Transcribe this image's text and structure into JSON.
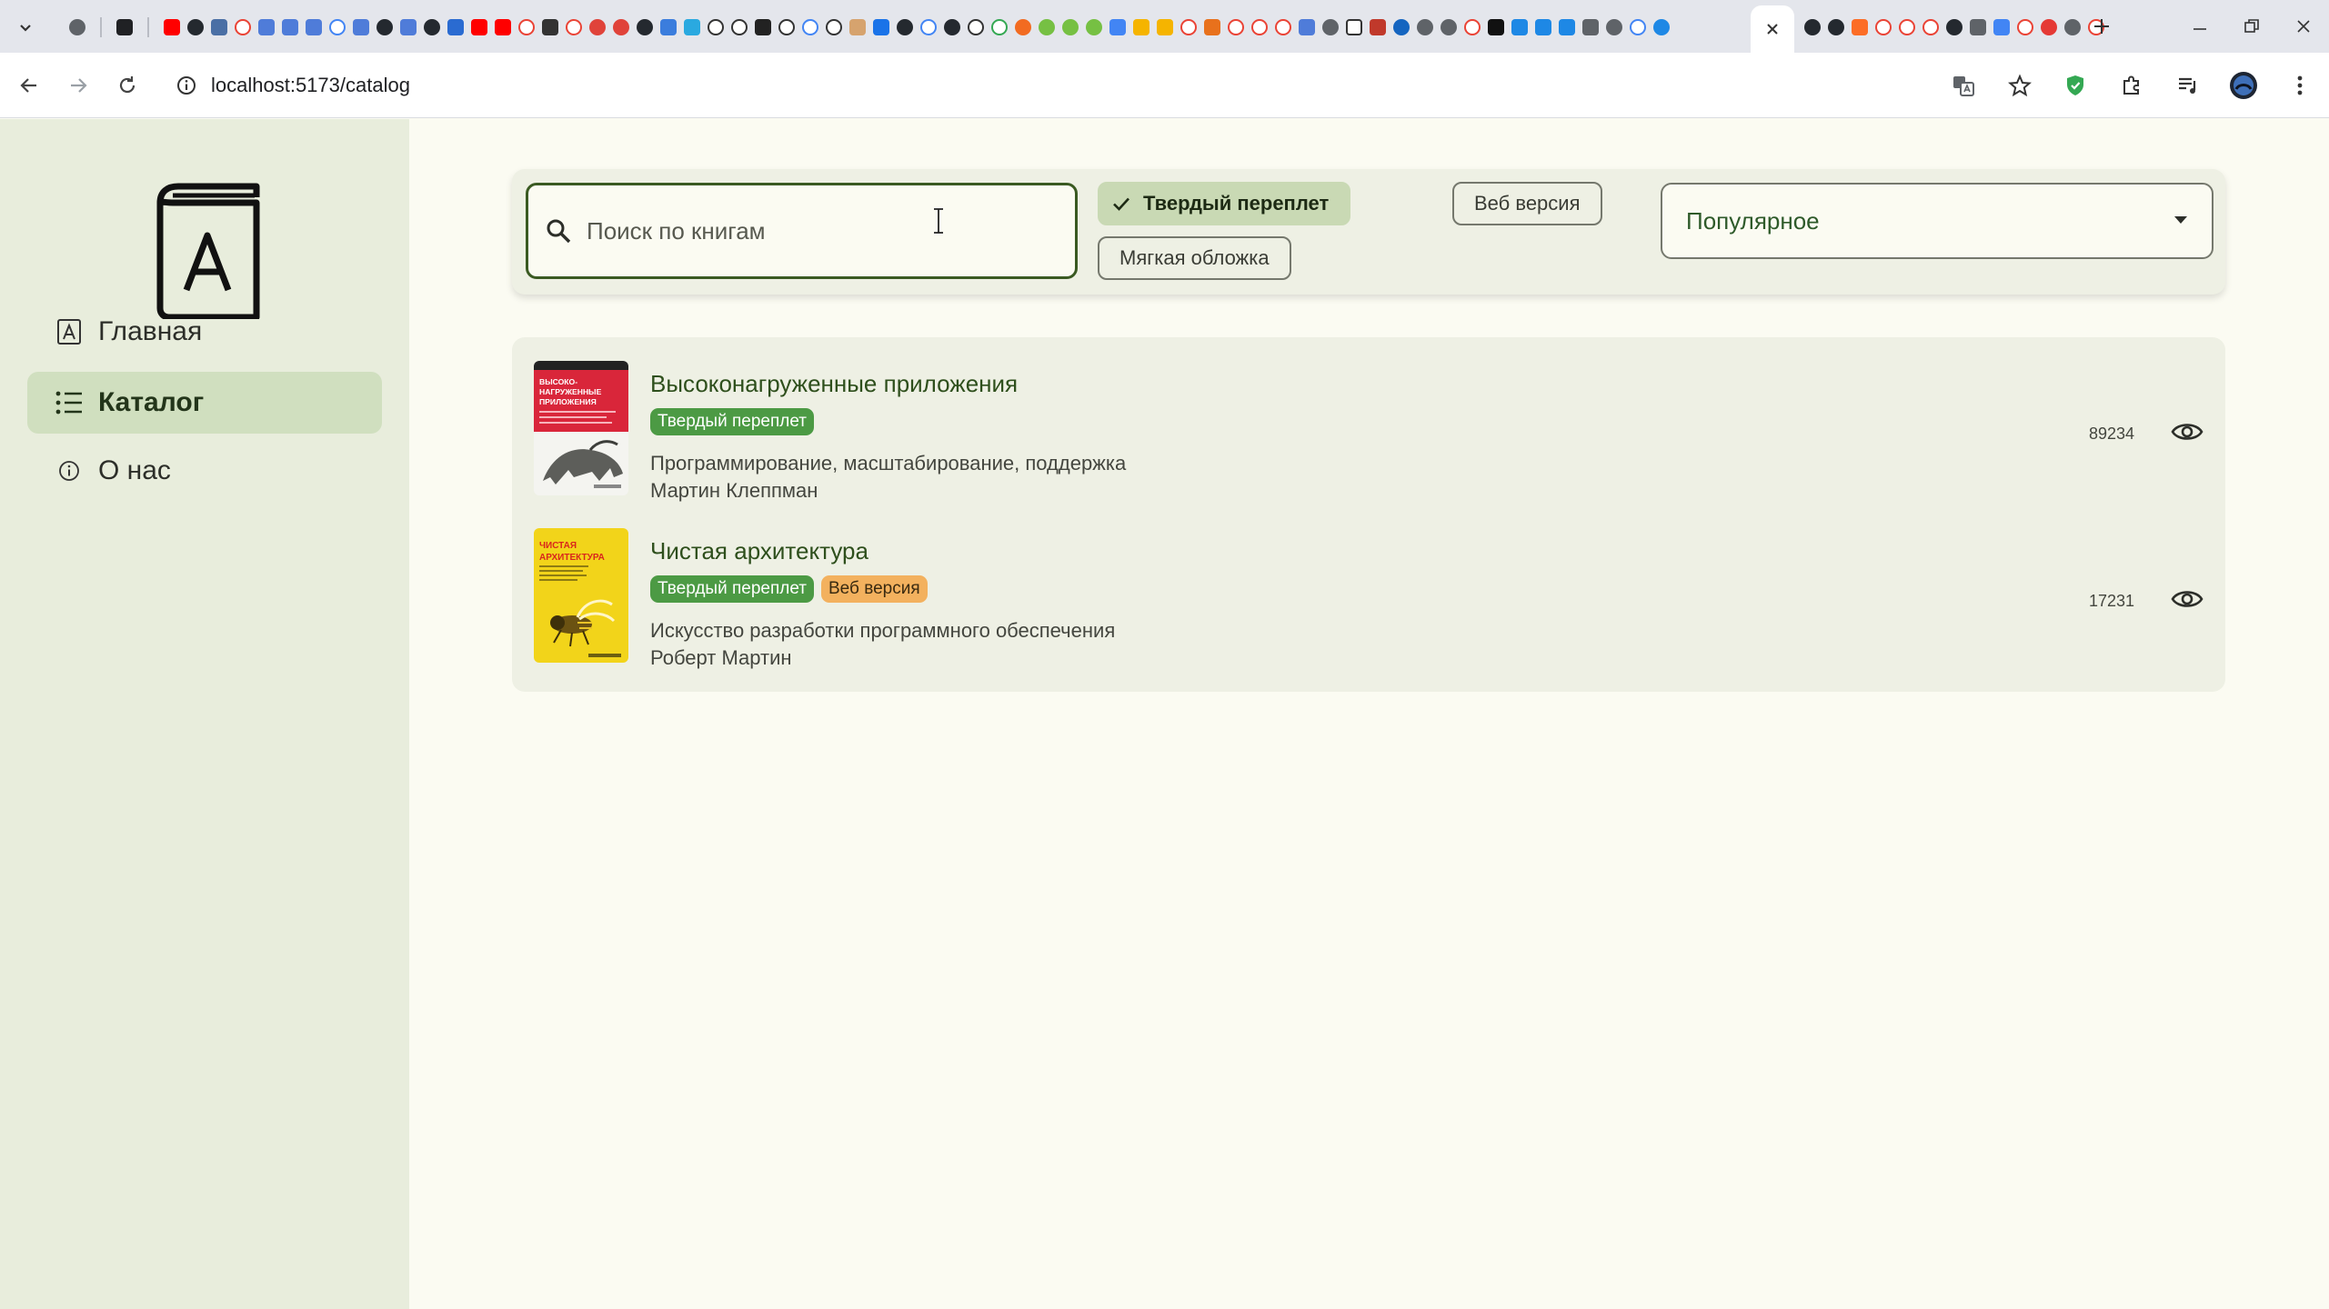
{
  "browser": {
    "url": "localhost:5173/catalog",
    "colors": {
      "tabbar": "#e4e6ec",
      "toolbar": "#ffffff"
    }
  },
  "sidebar": {
    "items": [
      {
        "label": "Главная",
        "icon": "home-letter-icon",
        "active": false
      },
      {
        "label": "Каталог",
        "icon": "list-icon",
        "active": true
      },
      {
        "label": "О нас",
        "icon": "info-icon",
        "active": false
      }
    ]
  },
  "filters": {
    "search_placeholder": "Поиск по книгам",
    "chips": [
      {
        "label": "Твердый переплет",
        "selected": true
      },
      {
        "label": "Веб версия",
        "selected": false
      },
      {
        "label": "Мягкая обложка",
        "selected": false
      }
    ],
    "sort": {
      "selected": "Популярное"
    }
  },
  "books": [
    {
      "title": "Высоконагруженные приложения",
      "tags": [
        "Твердый переплет"
      ],
      "subtitle": "Программирование, масштабирование, поддержка",
      "author": "Мартин Клеппман",
      "views": "89234",
      "cover": {
        "color": "#d9263a",
        "text": "ВЫСОКО-НАГРУЖЕННЫЕ ПРИЛОЖЕНИЯ"
      }
    },
    {
      "title": "Чистая архитектура",
      "tags": [
        "Твердый переплет",
        "Веб версия"
      ],
      "subtitle": "Искусство разработки программного обеспечения",
      "author": "Роберт Мартин",
      "views": "17231",
      "cover": {
        "color": "#f2d41a",
        "text": "ЧИСТАЯ АРХИТЕКТУРА"
      }
    }
  ],
  "theme": {
    "accent": "#3a5a22",
    "sidebar_bg": "#e8eddc",
    "active_nav": "#d0dfbf",
    "tag_hard": "#4c9a44",
    "tag_web": "#f3b15e"
  }
}
